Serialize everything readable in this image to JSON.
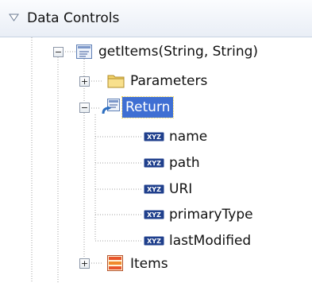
{
  "panel": {
    "title": "Data Controls",
    "header_icon": "chevron-down-icon"
  },
  "tree": {
    "method": {
      "label": "getItems(String, String)",
      "icon": "method-icon",
      "expanded": true
    },
    "parameters": {
      "label": "Parameters",
      "icon": "folder-icon",
      "expanded": false
    },
    "return": {
      "label": "Return",
      "icon": "return-icon",
      "expanded": true,
      "selected": true
    },
    "attributes": [
      {
        "label": "name",
        "icon": "xyz-attribute-icon"
      },
      {
        "label": "path",
        "icon": "xyz-attribute-icon"
      },
      {
        "label": "URI",
        "icon": "xyz-attribute-icon"
      },
      {
        "label": "primaryType",
        "icon": "xyz-attribute-icon"
      },
      {
        "label": "lastModified",
        "icon": "xyz-attribute-icon"
      }
    ],
    "items": {
      "label": "Items",
      "icon": "collection-icon",
      "expanded": false
    }
  },
  "colors": {
    "selection": "#3f6fd3",
    "header_bg": "#e9eef6",
    "folder": "#f3d36b",
    "collection": "#e8552b",
    "xyz_badge": "#1f3f8c"
  }
}
